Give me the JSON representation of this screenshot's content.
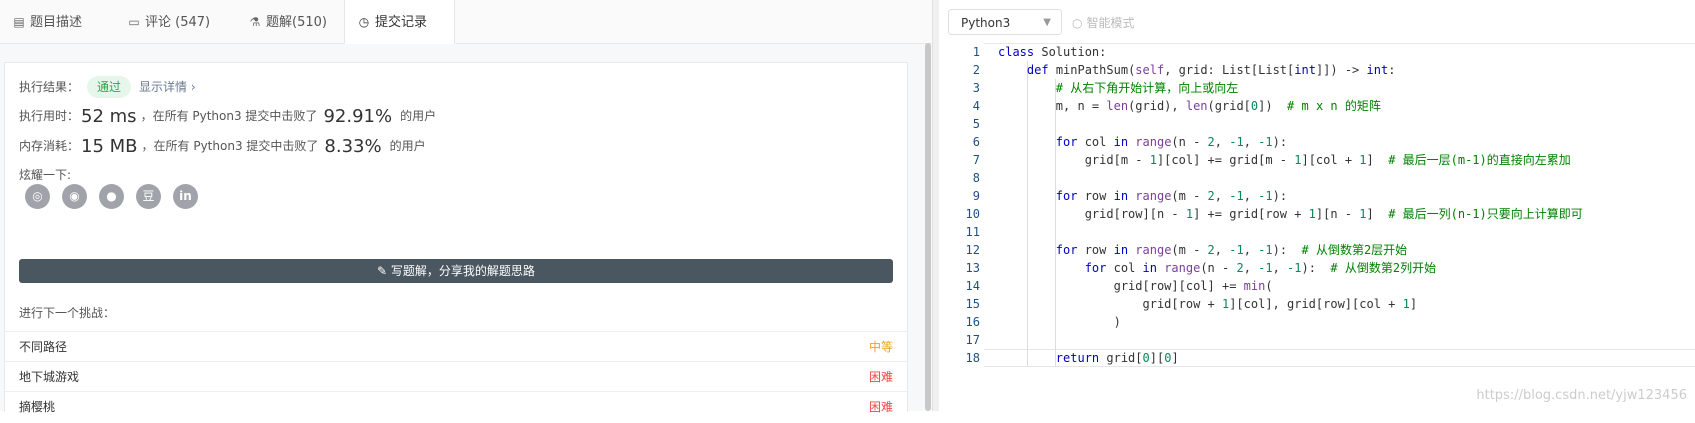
{
  "tabs": [
    {
      "label": "题目描述",
      "icon": "description-icon"
    },
    {
      "label": "评论 (547)",
      "icon": "comment-icon"
    },
    {
      "label": "题解(510)",
      "icon": "flask-icon"
    },
    {
      "label": "提交记录",
      "icon": "clock-icon"
    }
  ],
  "result": {
    "label": "执行结果：",
    "status": "通过",
    "detail": "显示详情 ›",
    "runtime_label": "执行用时：",
    "runtime_value": "52 ms",
    "runtime_mid": "，在所有 Python3 提交中击败了",
    "runtime_pct": "92.91%",
    "runtime_suffix": "的用户",
    "memory_label": "内存消耗：",
    "memory_value": "15 MB",
    "memory_mid": "，在所有 Python3 提交中击败了",
    "memory_pct": "8.33%",
    "memory_suffix": "的用户",
    "share_label": "炫耀一下:",
    "share_icons": [
      "wechat-icon",
      "weibo-icon",
      "qq-icon",
      "douban-icon",
      "linkedin-icon"
    ],
    "write_button": "写题解，分享我的解题思路",
    "next_label": "进行下一个挑战：",
    "problems": [
      {
        "name": "不同路径",
        "level": "中等"
      },
      {
        "name": "地下城游戏",
        "level": "困难"
      },
      {
        "name": "摘樱桃",
        "level": "困难"
      }
    ]
  },
  "toolbar": {
    "language": "Python3",
    "smart_mode": "智能模式"
  },
  "code": {
    "line_numbers": [
      "1",
      "2",
      "3",
      "4",
      "5",
      "6",
      "7",
      "8",
      "9",
      "10",
      "11",
      "12",
      "13",
      "14",
      "15",
      "16",
      "17",
      "18"
    ],
    "lines": [
      "class Solution:",
      "    def minPathSum(self, grid: List[List[int]]) -> int:",
      "        # 从右下角开始计算，向上或向左",
      "        m, n = len(grid), len(grid[0])  # m x n 的矩阵",
      "",
      "        for col in range(n - 2, -1, -1):",
      "            grid[m - 1][col] += grid[m - 1][col + 1]  # 最后一层(m-1)的直接向左累加",
      "",
      "        for row in range(m - 2, -1, -1):",
      "            grid[row][n - 1] += grid[row + 1][n - 1]  # 最后一列(n-1)只要向上计算即可",
      "",
      "        for row in range(m - 2, -1, -1):  # 从倒数第2层开始",
      "            for col in range(n - 2, -1, -1):  # 从倒数第2列开始",
      "                grid[row][col] += min(",
      "                    grid[row + 1][col], grid[row][col + 1]",
      "                )",
      "",
      "        return grid[0][0]"
    ]
  },
  "watermark": "https://blog.csdn.net/yjw123456"
}
